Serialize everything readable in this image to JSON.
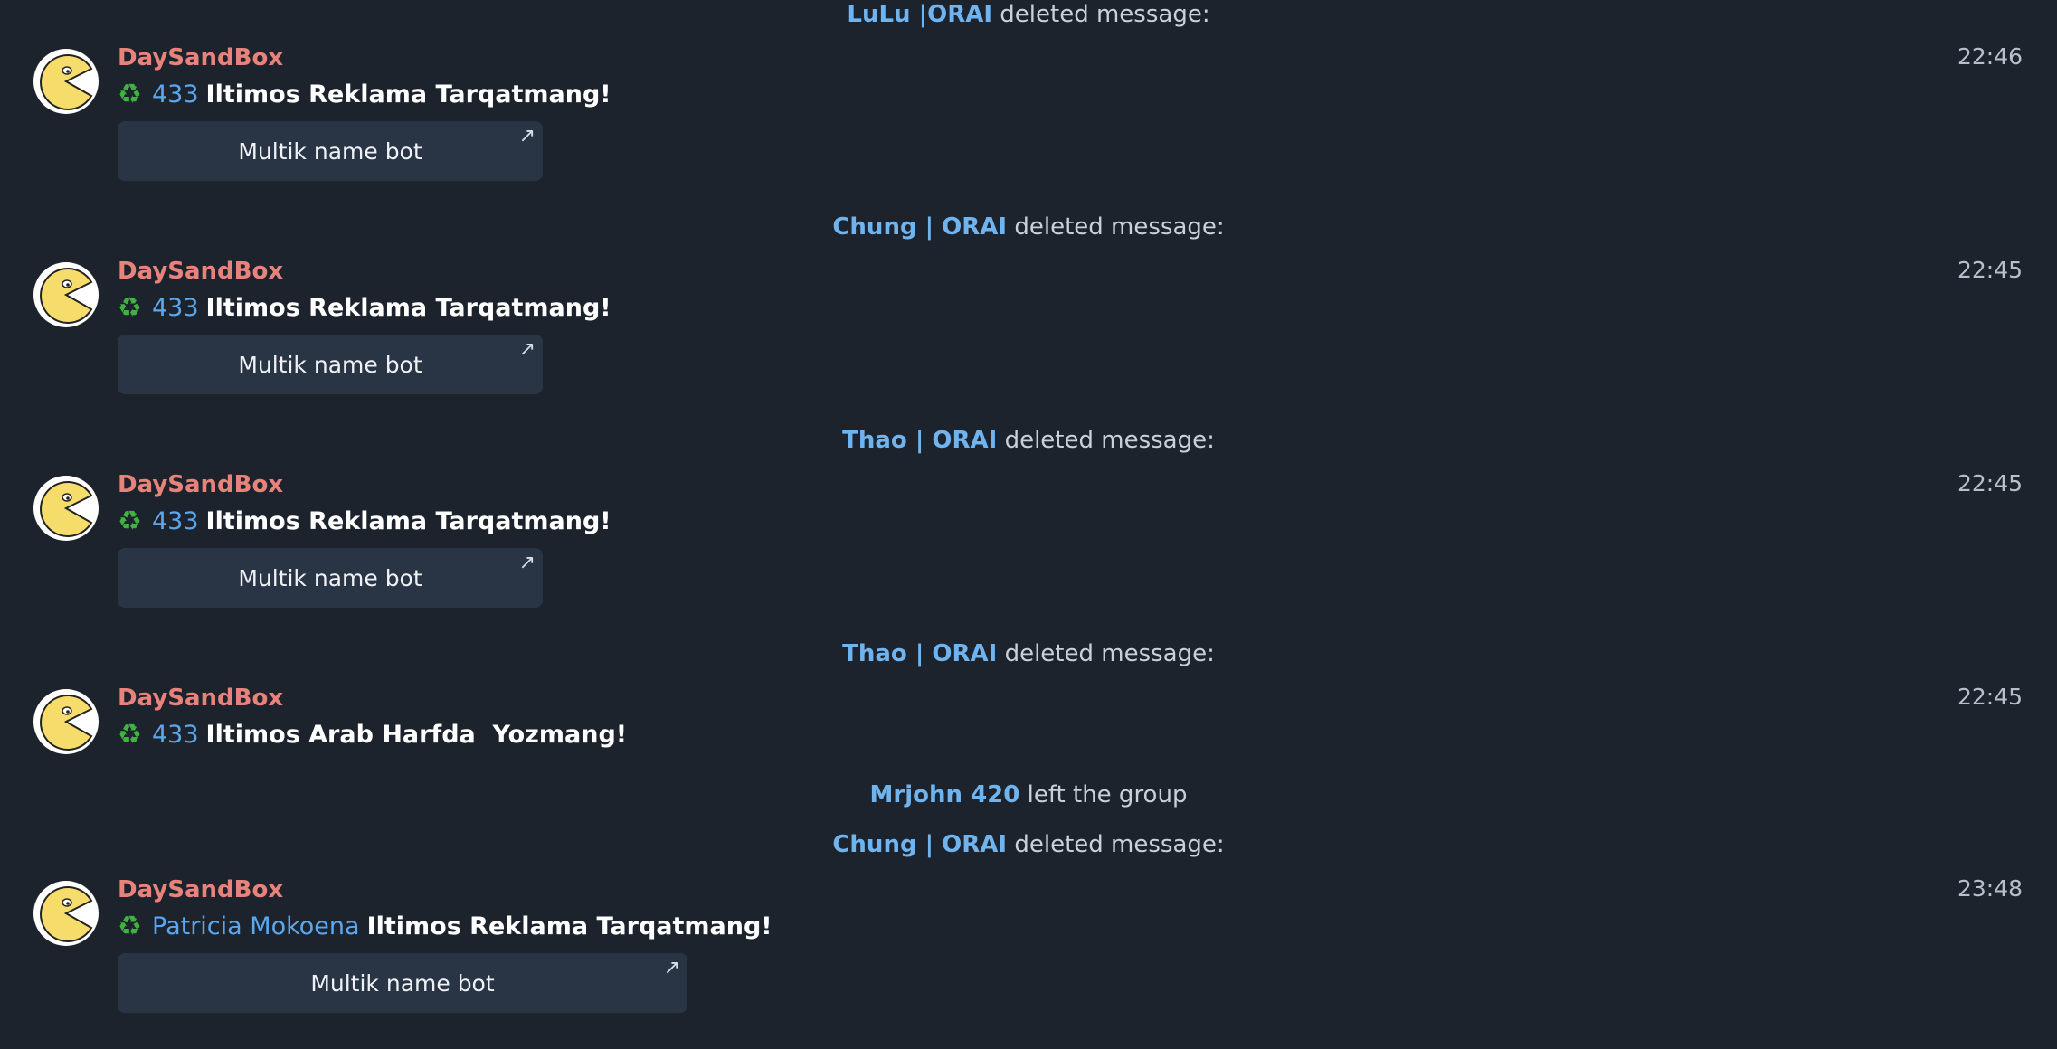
{
  "chat": {
    "events": [
      {
        "type": "service",
        "who": "LuLu |ORAI",
        "action": "deleted message:"
      },
      {
        "type": "message",
        "sender": "DaySandBox",
        "time": "22:46",
        "tag": "433",
        "text": "Iltimos Reklama Tarqatmang!",
        "button": "Multik name bot"
      },
      {
        "type": "service",
        "who": "Chung | ORAI",
        "action": "deleted message:"
      },
      {
        "type": "message",
        "sender": "DaySandBox",
        "time": "22:45",
        "tag": "433",
        "text": "Iltimos Reklama Tarqatmang!",
        "button": "Multik name bot"
      },
      {
        "type": "service",
        "who": "Thao | ORAI",
        "action": "deleted message:"
      },
      {
        "type": "message",
        "sender": "DaySandBox",
        "time": "22:45",
        "tag": "433",
        "text": "Iltimos Reklama Tarqatmang!",
        "button": "Multik name bot"
      },
      {
        "type": "service",
        "who": "Thao | ORAI",
        "action": "deleted message:"
      },
      {
        "type": "message",
        "sender": "DaySandBox",
        "time": "22:45",
        "tag": "433",
        "text": "Iltimos Arab Harfda  Yozmang!",
        "button": null
      },
      {
        "type": "service",
        "who": "Mrjohn 420",
        "action": "left the group"
      },
      {
        "type": "service",
        "who": "Chung | ORAI",
        "action": "deleted message:"
      },
      {
        "type": "message",
        "sender": "DaySandBox",
        "time": "23:48",
        "tag": "Patricia Mokoena",
        "text": "Iltimos Reklama Tarqatmang!",
        "button": "Multik name bot"
      }
    ],
    "icons": {
      "recycle": "recycle-icon",
      "button_arrow": "external-link-arrow-icon",
      "avatar": "pacman-avatar-icon"
    }
  }
}
